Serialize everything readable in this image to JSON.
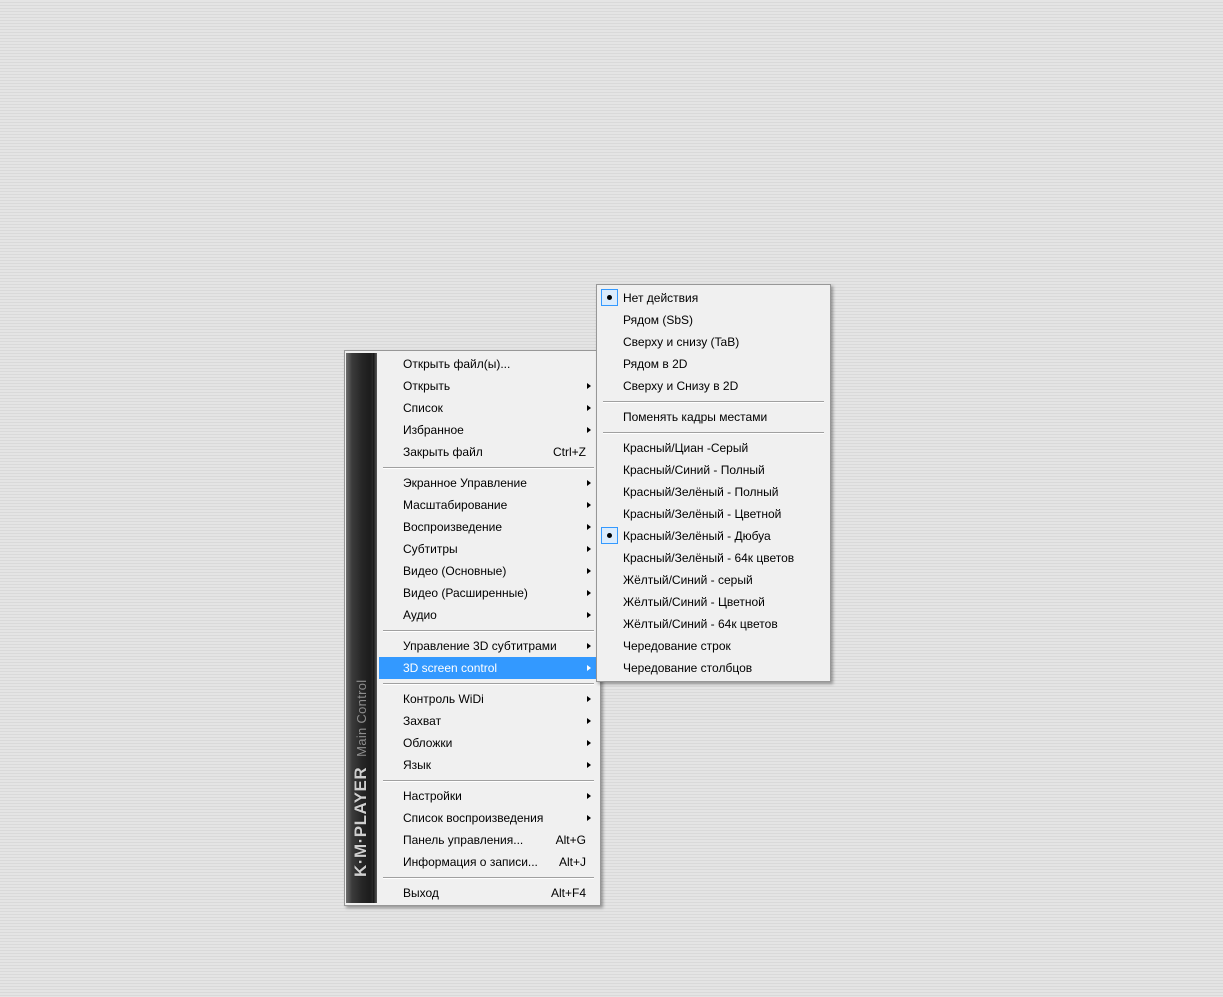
{
  "brand": {
    "logo": "K·M·PLAYER",
    "subtitle": "Main Control"
  },
  "main_menu": [
    {
      "type": "item",
      "label": "Открыть файл(ы)...",
      "name": "open-files"
    },
    {
      "type": "item",
      "label": "Открыть",
      "name": "open",
      "submenu": true
    },
    {
      "type": "item",
      "label": "Список",
      "name": "list",
      "submenu": true
    },
    {
      "type": "item",
      "label": "Избранное",
      "name": "favorites",
      "submenu": true
    },
    {
      "type": "item",
      "label": "Закрыть файл",
      "name": "close-file",
      "shortcut": "Ctrl+Z"
    },
    {
      "type": "separator"
    },
    {
      "type": "item",
      "label": "Экранное Управление",
      "name": "screen-control",
      "submenu": true
    },
    {
      "type": "item",
      "label": "Масштабирование",
      "name": "scaling",
      "submenu": true
    },
    {
      "type": "item",
      "label": "Воспроизведение",
      "name": "playback",
      "submenu": true
    },
    {
      "type": "item",
      "label": "Субтитры",
      "name": "subtitles",
      "submenu": true
    },
    {
      "type": "item",
      "label": "Видео (Основные)",
      "name": "video-basic",
      "submenu": true
    },
    {
      "type": "item",
      "label": "Видео (Расширенные)",
      "name": "video-advanced",
      "submenu": true
    },
    {
      "type": "item",
      "label": "Аудио",
      "name": "audio",
      "submenu": true
    },
    {
      "type": "separator"
    },
    {
      "type": "item",
      "label": "Управление 3D субтитрами",
      "name": "3d-subtitles-control",
      "submenu": true
    },
    {
      "type": "item",
      "label": "3D screen control",
      "name": "3d-screen-control",
      "submenu": true,
      "highlighted": true
    },
    {
      "type": "separator"
    },
    {
      "type": "item",
      "label": "Контроль WiDi",
      "name": "widi-control",
      "submenu": true
    },
    {
      "type": "item",
      "label": "Захват",
      "name": "capture",
      "submenu": true
    },
    {
      "type": "item",
      "label": "Обложки",
      "name": "skins",
      "submenu": true
    },
    {
      "type": "item",
      "label": "Язык",
      "name": "language",
      "submenu": true
    },
    {
      "type": "separator"
    },
    {
      "type": "item",
      "label": "Настройки",
      "name": "settings",
      "submenu": true
    },
    {
      "type": "item",
      "label": "Список воспроизведения",
      "name": "playlist",
      "submenu": true
    },
    {
      "type": "item",
      "label": "Панель управления...",
      "name": "control-panel",
      "shortcut": "Alt+G"
    },
    {
      "type": "item",
      "label": "Информация о записи...",
      "name": "record-info",
      "shortcut": "Alt+J"
    },
    {
      "type": "separator"
    },
    {
      "type": "item",
      "label": "Выход",
      "name": "exit",
      "shortcut": "Alt+F4"
    }
  ],
  "submenu_3d": [
    {
      "type": "item",
      "label": "Нет действия",
      "name": "no-action",
      "checked": true
    },
    {
      "type": "item",
      "label": "Рядом (SbS)",
      "name": "side-by-side"
    },
    {
      "type": "item",
      "label": "Сверху и снизу (TaB)",
      "name": "top-and-bottom"
    },
    {
      "type": "item",
      "label": "Рядом в 2D",
      "name": "side-by-side-2d"
    },
    {
      "type": "item",
      "label": "Сверху и Снизу в 2D",
      "name": "top-and-bottom-2d"
    },
    {
      "type": "separator"
    },
    {
      "type": "item",
      "label": "Поменять кадры местами",
      "name": "swap-frames"
    },
    {
      "type": "separator"
    },
    {
      "type": "item",
      "label": "Красный/Циан -Серый",
      "name": "red-cyan-gray"
    },
    {
      "type": "item",
      "label": "Красный/Синий - Полный",
      "name": "red-blue-full"
    },
    {
      "type": "item",
      "label": "Красный/Зелёный - Полный",
      "name": "red-green-full"
    },
    {
      "type": "item",
      "label": "Красный/Зелёный - Цветной",
      "name": "red-green-color"
    },
    {
      "type": "item",
      "label": "Красный/Зелёный - Дюбуа",
      "name": "red-green-dubois",
      "checked": true
    },
    {
      "type": "item",
      "label": "Красный/Зелёный - 64к цветов",
      "name": "red-green-64k"
    },
    {
      "type": "item",
      "label": "Жёлтый/Синий - серый",
      "name": "yellow-blue-gray"
    },
    {
      "type": "item",
      "label": "Жёлтый/Синий - Цветной",
      "name": "yellow-blue-color"
    },
    {
      "type": "item",
      "label": "Жёлтый/Синий - 64к цветов",
      "name": "yellow-blue-64k"
    },
    {
      "type": "item",
      "label": "Чередование строк",
      "name": "row-interleave"
    },
    {
      "type": "item",
      "label": "Чередование столбцов",
      "name": "column-interleave"
    }
  ],
  "colors": {
    "highlight": "#3399ff",
    "menu_bg": "#f0f0f0",
    "brand_strip": "#1c1c1c"
  }
}
